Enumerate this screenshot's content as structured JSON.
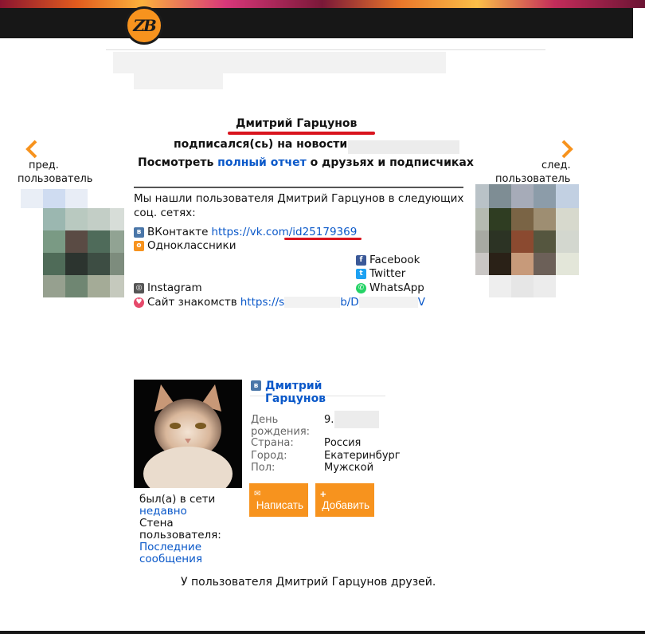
{
  "site": {
    "logo_text": "ZB"
  },
  "header": {
    "user_name": "Дмитрий Гарцунов",
    "subscribed_text": "подписался(сь) на новости",
    "report_prefix": "Посмотреть",
    "report_link": "полный отчет",
    "report_suffix": "о друзьях и подписчиках"
  },
  "nav": {
    "prev_label_line1": "пред.",
    "prev_label_line2": "пользователь",
    "next_label_line1": "след.",
    "next_label_line2": "пользователь"
  },
  "social": {
    "intro": "Мы нашли пользователя Дмитрий Гарцунов в следующих соц. сетях:",
    "vk_label": "ВКонтакте",
    "vk_url": "https://vk.com/id25179369",
    "ok_label": "Одноклассники",
    "facebook_label": "Facebook",
    "twitter_label": "Twitter",
    "whatsapp_label": "WhatsApp",
    "instagram_label": "Instagram",
    "dating_label": "Сайт знакомств",
    "dating_url_start": "https://s",
    "dating_url_mid": "b/D",
    "dating_url_end": "V"
  },
  "profile": {
    "name": "Дмитрий Гарцунов",
    "birthday_label": "День рождения:",
    "birthday_value": "9.",
    "country_label": "Страна:",
    "country_value": "Россия",
    "city_label": "Город:",
    "city_value": "Екатеринбург",
    "gender_label": "Пол:",
    "gender_value": "Мужской",
    "write_button": "Написать",
    "add_button": "Добавить",
    "online_label": "был(а) в сети",
    "online_value": "недавно",
    "wall_label": "Стена пользователя:",
    "wall_link": "Последние сообщения",
    "friends_text": "У пользователя Дмитрий Гарцунов друзей."
  },
  "colors": {
    "accent": "#f7931e",
    "link": "#0a58c9",
    "underline": "#d9141e",
    "vk": "#4a76a8"
  }
}
